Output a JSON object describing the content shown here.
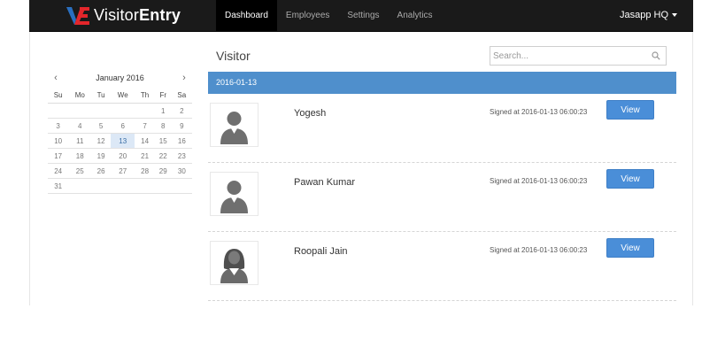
{
  "app": {
    "brand_text": "Visitor",
    "brand_bold": "Entry",
    "nav": [
      "Dashboard",
      "Employees",
      "Settings",
      "Analytics"
    ],
    "active_nav": "Dashboard",
    "user": "Jasapp HQ"
  },
  "calendar": {
    "month_label": "January 2016",
    "prev": "‹",
    "next": "›",
    "weekdays": [
      "Su",
      "Mo",
      "Tu",
      "We",
      "Th",
      "Fr",
      "Sa"
    ],
    "weeks": [
      [
        "",
        "",
        "",
        "",
        "",
        "1",
        "2"
      ],
      [
        "3",
        "4",
        "5",
        "6",
        "7",
        "8",
        "9"
      ],
      [
        "10",
        "11",
        "12",
        "13",
        "14",
        "15",
        "16"
      ],
      [
        "17",
        "18",
        "19",
        "20",
        "21",
        "22",
        "23"
      ],
      [
        "24",
        "25",
        "26",
        "27",
        "28",
        "29",
        "30"
      ],
      [
        "31",
        "",
        "",
        "",
        "",
        "",
        ""
      ]
    ],
    "selected": "13"
  },
  "main": {
    "title": "Visitor",
    "search_placeholder": "Search...",
    "date_header": "2016-01-13",
    "visitors": [
      {
        "name": "Yogesh",
        "signed": "Signed at 2016-01-13 06:00:23",
        "button": "View",
        "avatar": "male"
      },
      {
        "name": "Pawan Kumar",
        "signed": "Signed at 2016-01-13 06:00:23",
        "button": "View",
        "avatar": "male"
      },
      {
        "name": "Roopali Jain",
        "signed": "Signed at 2016-01-13 06:00:23",
        "button": "View",
        "avatar": "female"
      }
    ]
  },
  "colors": {
    "navbar": "#1a1a1a",
    "accent": "#4f8fcc",
    "button": "#4a8ed8",
    "logo_red": "#e3262b",
    "logo_blue": "#2a6fc0"
  }
}
